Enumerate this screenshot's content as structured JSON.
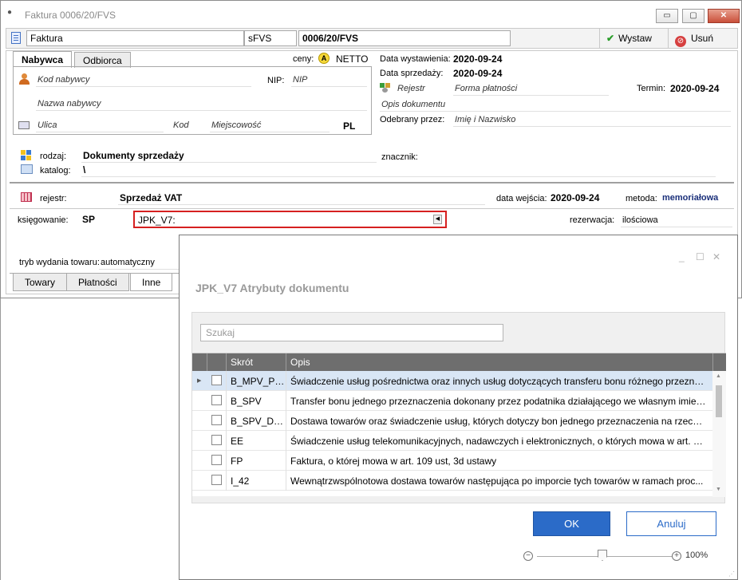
{
  "window": {
    "title": "Faktura 0006/20/FVS",
    "btn_min": "▭",
    "btn_max": "▢",
    "btn_close": "✕"
  },
  "toolbar": {
    "doc_type": "Faktura",
    "series": "sFVS",
    "number": "0006/20/FVS",
    "issue_label": "Wystaw",
    "cancel_label": "Usuń"
  },
  "tabs": {
    "buyer": "Nabywca",
    "recipient": "Odbiorca"
  },
  "buyer": {
    "code_placeholder": "Kod nabywcy",
    "nip_label": "NIP:",
    "nip_placeholder": "NIP",
    "name_placeholder": "Nazwa nabywcy",
    "street_placeholder": "Ulica",
    "postcode_placeholder": "Kod",
    "city_placeholder": "Miejscowość",
    "country": "PL"
  },
  "prices": {
    "label": "ceny:",
    "badge": "A",
    "value": "NETTO"
  },
  "dates": {
    "issue_label": "Data wystawienia:",
    "issue_value": "2020-09-24",
    "sale_label": "Data sprzedaży:",
    "sale_value": "2020-09-24",
    "register_placeholder": "Rejestr",
    "payment_placeholder": "Forma płatności",
    "term_label": "Termin:",
    "term_value": "2020-09-24",
    "desc_placeholder": "Opis dokumentu",
    "received_label": "Odebrany przez:",
    "received_placeholder": "Imię i Nazwisko"
  },
  "classification": {
    "type_label": "rodzaj:",
    "type_value": "Dokumenty sprzedaży",
    "marker_label": "znacznik:",
    "catalog_label": "katalog:",
    "catalog_value": "\\"
  },
  "registry": {
    "label": "rejestr:",
    "value": "Sprzedaż VAT",
    "entry_date_label": "data wejścia:",
    "entry_date_value": "2020-09-24",
    "method_label": "metoda:",
    "method_value": "memoriałowa",
    "posting_label": "księgowanie:",
    "posting_value": "SP",
    "jpk_value": "JPK_V7:",
    "reservation_label": "rezerwacja:",
    "reservation_value": "ilościowa",
    "issue_mode_label": "tryb wydania towaru:",
    "issue_mode_value": "automatyczny"
  },
  "bottom_tabs": [
    "Towary",
    "Płatności",
    "Inne"
  ],
  "dialog": {
    "title": "JPK_V7 Atrybuty dokumentu",
    "search_placeholder": "Szukaj",
    "columns": {
      "code": "Skrót",
      "desc": "Opis"
    },
    "rows": [
      {
        "code": "B_MPV_PR...",
        "desc": "Świadczenie usług pośrednictwa oraz innych usług dotyczących transferu bonu różnego przeznac..."
      },
      {
        "code": "B_SPV",
        "desc": "Transfer bonu jednego przeznaczenia dokonany przez podatnika działającego we własnym imieni..."
      },
      {
        "code": "B_SPV_DO...",
        "desc": "Dostawa towarów oraz świadczenie usług, których dotyczy bon jednego przeznaczenia na rzecz p..."
      },
      {
        "code": "EE",
        "desc": "Świadczenie usług telekomunikacyjnych, nadawczych i elektronicznych, o których mowa w art. 28..."
      },
      {
        "code": "FP",
        "desc": "Faktura, o której mowa w art. 109 ust, 3d ustawy"
      },
      {
        "code": "I_42",
        "desc": "Wewnątrzwspólnotowa dostawa towarów następująca po imporcie tych towarów w ramach proc..."
      }
    ],
    "ok_label": "OK",
    "cancel_label": "Anuluj",
    "zoom_label": "100%"
  },
  "colors": {
    "accent": "#2b6bc8",
    "highlight_border": "#d62020",
    "grid_header": "#6e6e6e",
    "selected_row": "#d9e6f5"
  },
  "icons": [
    "document-icon",
    "check-icon",
    "cancel-icon",
    "person-icon",
    "address-card-icon",
    "grid-icon",
    "folder-icon",
    "register-icon",
    "chevron-left-icon",
    "zoom-minus-icon",
    "zoom-plus-icon"
  ]
}
